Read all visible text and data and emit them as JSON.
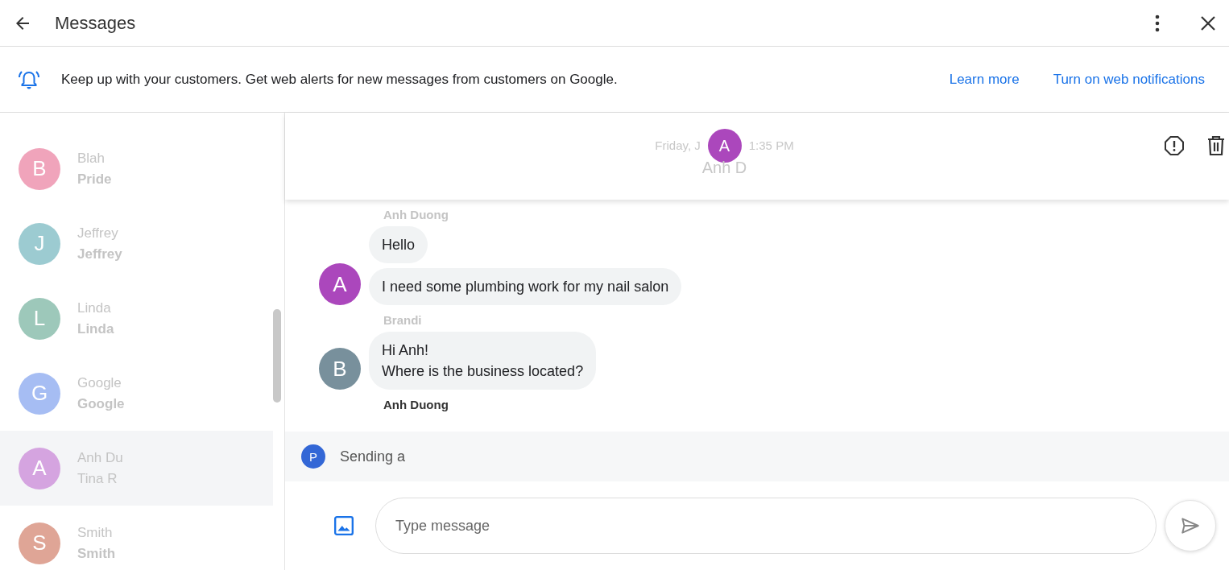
{
  "app_bar": {
    "title": "Messages"
  },
  "banner": {
    "text": "Keep up with your customers. Get web alerts for new messages from customers on Google.",
    "links": [
      "Learn more",
      "Turn on web notifications"
    ]
  },
  "conversations": [
    {
      "initial": "B",
      "name": "Blah",
      "subtitle": "Pride",
      "color": "#f0a4bb",
      "selected": false
    },
    {
      "initial": "J",
      "name": "Jeffrey",
      "subtitle": "Jeffrey",
      "color": "#9ccbd1",
      "selected": false
    },
    {
      "initial": "L",
      "name": "Linda",
      "subtitle": "Linda",
      "color": "#9dc8ba",
      "selected": false
    },
    {
      "initial": "G",
      "name": "Google",
      "subtitle": "Google",
      "color": "#a6bdf3",
      "selected": false
    },
    {
      "initial": "A",
      "name": "Anh Du",
      "subtitle": "Tina R",
      "color": "#d5a4e0",
      "selected": true
    },
    {
      "initial": "S",
      "name": "Smith",
      "subtitle": "Smith",
      "color": "#dfa596",
      "selected": false
    }
  ],
  "chat_header": {
    "initial": "A",
    "color": "#ab47bc",
    "date": "Friday, J",
    "time": "1:35 PM",
    "name": "Anh D"
  },
  "messages": [
    {
      "sender": "Anh Duong",
      "sender_faded": true,
      "initial": "A",
      "color": "#ab47bc",
      "bubbles": [
        [
          "Hello"
        ],
        [
          "I need some plumbing work for my nail salon"
        ]
      ]
    },
    {
      "sender": "Brandi",
      "sender_faded": true,
      "initial": "B",
      "color": "#78909c",
      "bubbles": [
        [
          "Hi Anh!",
          "Where is the business located?"
        ]
      ]
    },
    {
      "sender": "Anh Duong",
      "sender_faded": false
    }
  ],
  "sending": {
    "initial": "P",
    "color": "#3367d6",
    "text": "Sending a"
  },
  "composer": {
    "placeholder": "Type message"
  }
}
